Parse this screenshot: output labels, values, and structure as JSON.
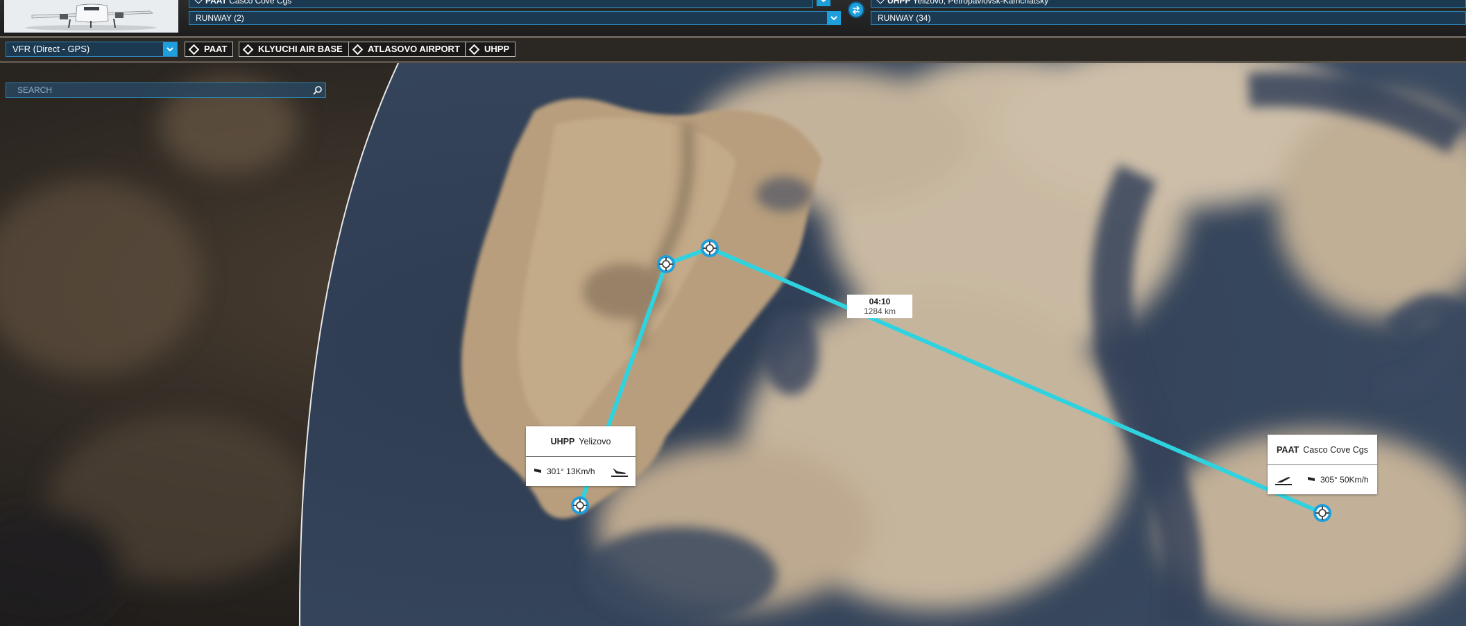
{
  "topbar": {
    "departure": {
      "icao": "PAAT",
      "name": "Casco Cove Cgs",
      "runway": "RUNWAY (2)"
    },
    "arrival": {
      "icao": "UHPP",
      "name": "Yelizovo, Petropavlovsk-Kamchatsky",
      "runway": "RUNWAY (34)"
    }
  },
  "filterbar": {
    "flight_type": "VFR (Direct - GPS)",
    "waypoints": [
      "PAAT",
      "KLYUCHI AIR BASE",
      "ATLASOVO AIRPORT",
      "UHPP"
    ]
  },
  "search": {
    "placeholder": "SEARCH"
  },
  "leg": {
    "time": "04:10",
    "distance": "1284 km"
  },
  "cards": {
    "arrival": {
      "icao": "UHPP",
      "name": "Yelizovo",
      "wind": "301° 13Km/h"
    },
    "departure": {
      "icao": "PAAT",
      "name": "Casco Cove Cgs",
      "wind": "305° 50Km/h"
    }
  },
  "colors": {
    "route": "#2fd3e0",
    "accent": "#1e9fdc",
    "field_bg": "#1b3a52"
  },
  "icons": [
    "swap-icon",
    "chevron-down-icon",
    "search-icon",
    "waypoint-marker-icon",
    "wind-sock-icon",
    "landing-icon",
    "takeoff-icon"
  ]
}
